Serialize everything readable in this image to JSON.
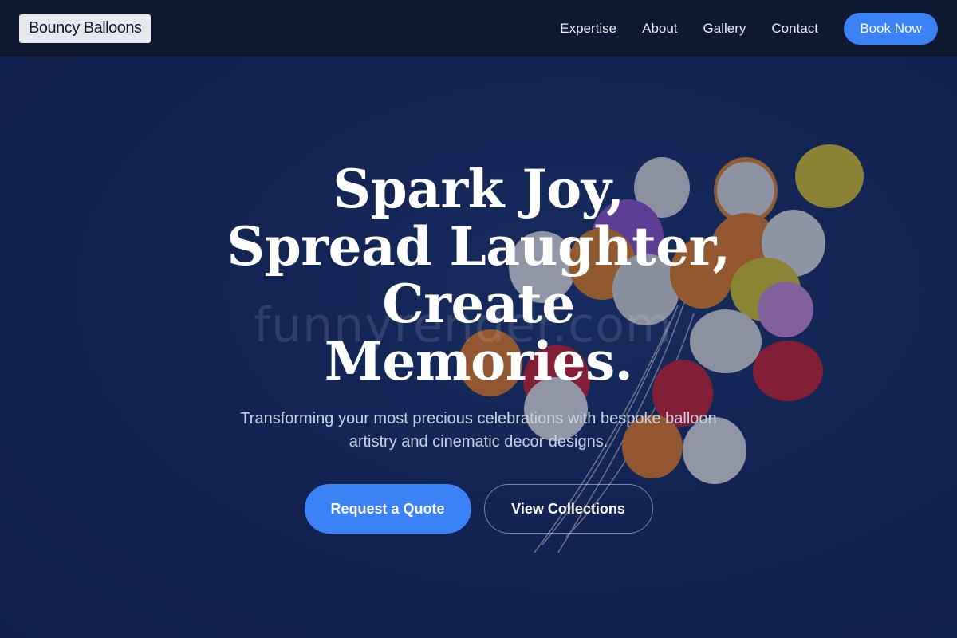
{
  "nav": {
    "logo": "Bouncy Balloons",
    "links": [
      "Expertise",
      "About",
      "Gallery",
      "Contact"
    ],
    "cta": "Book Now"
  },
  "hero": {
    "title": "Spark Joy, Spread Laughter, Create Memories.",
    "subtitle": "Transforming your most precious celebrations with bespoke balloon artistry and cinematic decor designs.",
    "watermark": "funnyrender.com",
    "primary_cta": "Request a Quote",
    "secondary_cta": "View Collections"
  },
  "colors": {
    "nav_bg": "#0e1830",
    "hero_bg": "#13264f",
    "accent": "#3b82f6"
  }
}
